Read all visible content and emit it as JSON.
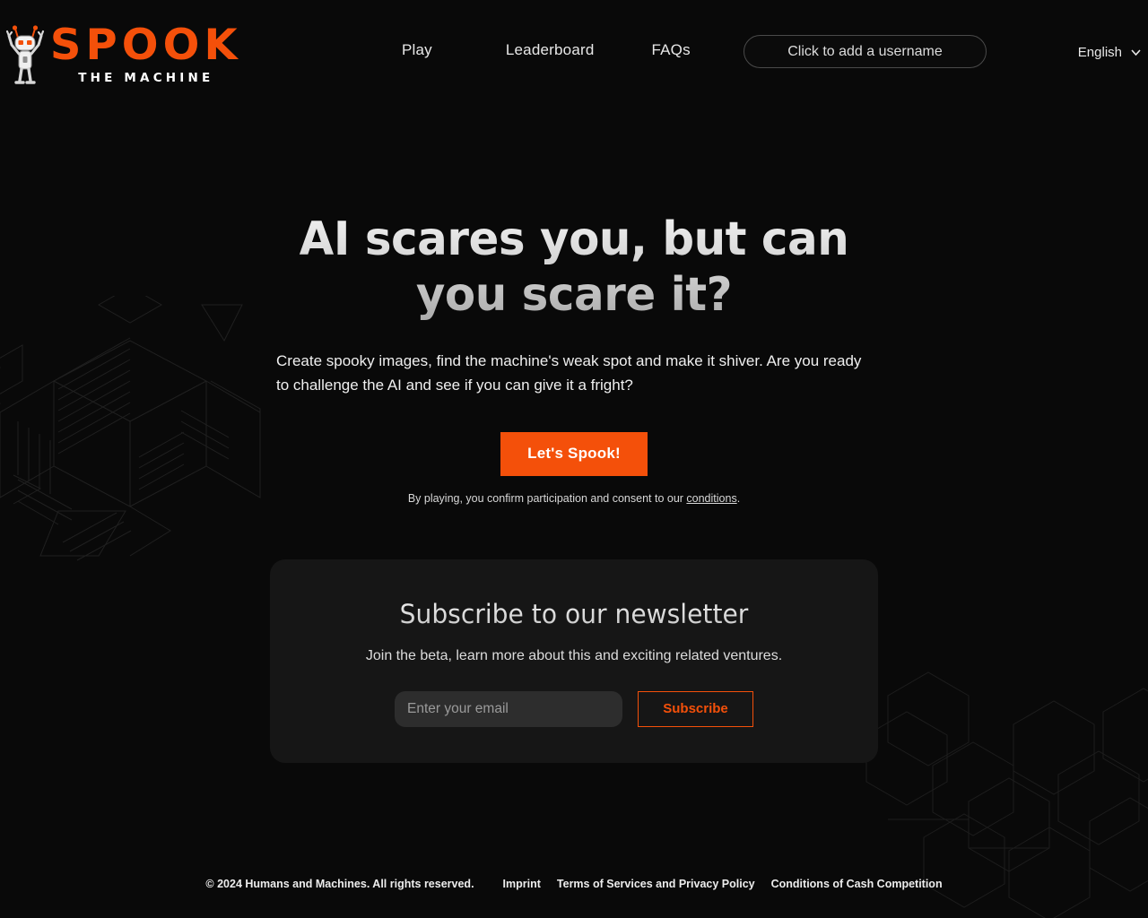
{
  "brand": {
    "logo_icon": "robot-mascot-icon",
    "wordmark": "SPOOK",
    "tagline": "THE MACHINE",
    "accent_color": "#f4500a",
    "background_color": "#090909"
  },
  "header": {
    "nav": [
      {
        "label": "Play",
        "name": "nav-play"
      },
      {
        "label": "Leaderboard",
        "name": "nav-leaderboard"
      },
      {
        "label": "FAQs",
        "name": "nav-faqs"
      }
    ],
    "username_button": "Click to add a username",
    "language": {
      "selected": "English",
      "icon": "chevron-down-icon",
      "options": [
        "English"
      ]
    }
  },
  "hero": {
    "headline": "AI scares you, but can you scare it?",
    "subhead": "Create spooky images, find the machine's weak spot and make it shiver. Are you ready to challenge the AI and see if you can give it a fright?",
    "cta_label": "Let's Spook!",
    "disclaimer_before": "By playing, you confirm participation and consent to our ",
    "disclaimer_link": "conditions",
    "disclaimer_after": "."
  },
  "newsletter": {
    "title": "Subscribe to our newsletter",
    "subtitle": "Join the beta, learn more about this and exciting related ventures.",
    "email_placeholder": "Enter your email",
    "email_value": "",
    "submit_label": "Subscribe"
  },
  "footer": {
    "copyright": "© 2024 Humans and Machines. All rights reserved.",
    "links": [
      {
        "label": "Imprint",
        "name": "footer-link-imprint"
      },
      {
        "label": "Terms of Services and Privacy Policy",
        "name": "footer-link-terms"
      },
      {
        "label": "Conditions of Cash Competition",
        "name": "footer-link-conditions"
      }
    ]
  }
}
